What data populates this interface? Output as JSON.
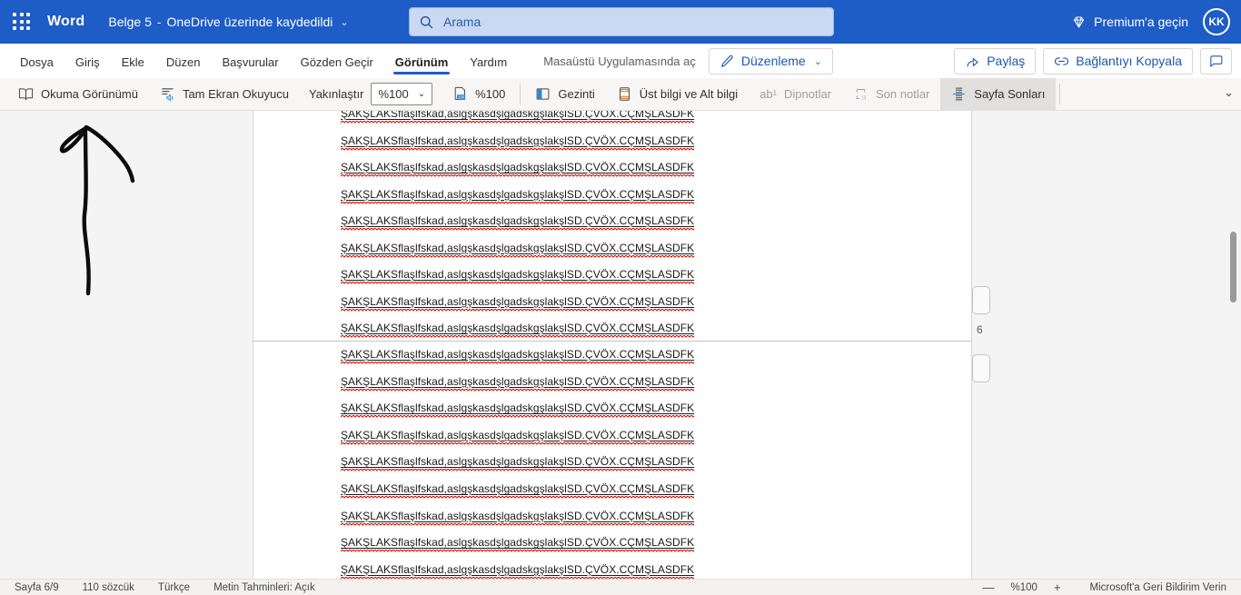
{
  "topbar": {
    "app_name": "Word",
    "doc_title": "Belge 5",
    "title_separator": "-",
    "save_status": "OneDrive üzerinde kaydedildi",
    "search_placeholder": "Arama",
    "premium_label": "Premium'a geçin",
    "avatar_initials": "KK"
  },
  "menubar": {
    "items": [
      "Dosya",
      "Giriş",
      "Ekle",
      "Düzen",
      "Başvurular",
      "Gözden Geçir",
      "Görünüm",
      "Yardım"
    ],
    "active_item": "Görünüm",
    "open_desktop_label": "Masaüstü Uygulamasında aç",
    "mode_button_label": "Düzenleme",
    "share_label": "Paylaş",
    "copy_link_label": "Bağlantıyı Kopyala"
  },
  "ribbon": {
    "reading_view": "Okuma Görünümü",
    "immersive_reader": "Tam Ekran Okuyucu",
    "zoom_label": "Yakınlaştır",
    "zoom_select_value": "%100",
    "zoom_to_label": "%100",
    "navigation": "Gezinti",
    "header_footer": "Üst bilgi ve Alt bilgi",
    "footnotes": "Dipnotlar",
    "footnotes_icon_text": "ab¹",
    "endnotes": "Son notlar",
    "page_breaks": "Sayfa Sonları"
  },
  "document": {
    "line_text": "ŞAKŞLAKSflaşlfskad,aslgşkasdşlgadskgşlakşlSD.ÇVÖX.CÇMŞLASDFK",
    "page1_visible_lines": 9,
    "page2_visible_lines": 9,
    "margin_page_number": "6"
  },
  "statusbar": {
    "page_indicator": "Sayfa 6/9",
    "word_count": "110 sözcük",
    "language": "Türkçe",
    "text_predictions": "Metin Tahminleri: Açık",
    "zoom_out": "—",
    "zoom_value": "%100",
    "zoom_in": "+",
    "feedback": "Microsoft'a Geri Bildirim Verin"
  },
  "colors": {
    "header_blue": "#1e5cc6",
    "accent_blue": "#1859b3",
    "search_fill": "#c9d9f1",
    "selected_ribbon_bg": "#e2e0de",
    "spellcheck_red": "#e00b00",
    "canvas_gray": "#f4f4f4"
  }
}
